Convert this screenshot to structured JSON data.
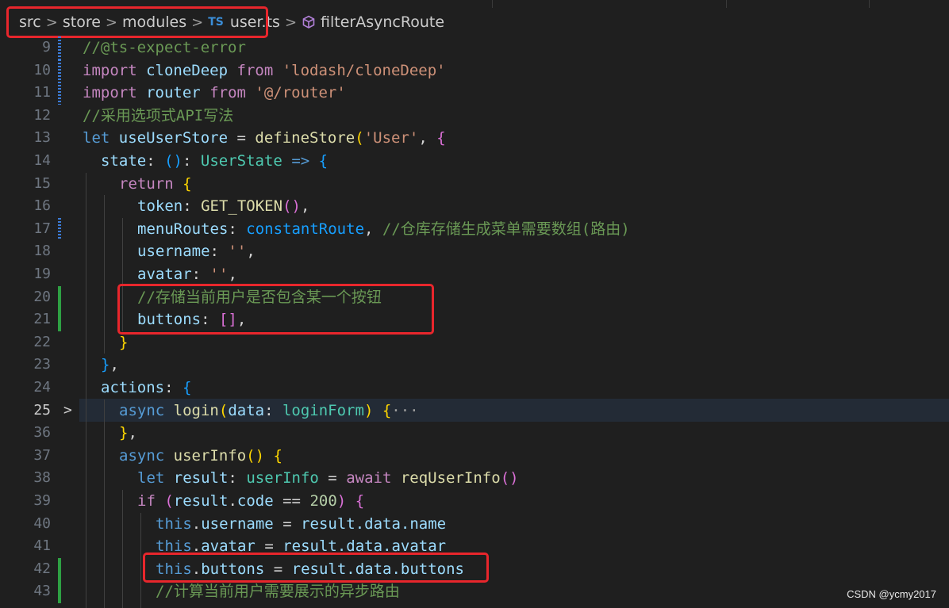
{
  "breadcrumb": {
    "items": [
      "src",
      "store",
      "modules",
      "user.ts",
      "filterAsyncRoute"
    ],
    "ts_badge": "TS",
    "separator": ">"
  },
  "gutter": {
    "line_numbers": [
      "9",
      "10",
      "11",
      "12",
      "13",
      "14",
      "15",
      "16",
      "17",
      "18",
      "19",
      "20",
      "21",
      "22",
      "23",
      "24",
      "25",
      "36",
      "37",
      "38",
      "39",
      "40",
      "41",
      "42",
      "43"
    ],
    "fold_chevron": ">"
  },
  "code": {
    "l9": {
      "comment": "//@ts-expect-error"
    },
    "l10": {
      "kw": "import",
      "name": "cloneDeep",
      "from": "from",
      "sp": " ",
      "str": "'lodash/cloneDeep'"
    },
    "l11": {
      "kw": "import",
      "name": "router",
      "from": "from",
      "str": "'@/router'"
    },
    "l12": {
      "comment": "//采用选项式API写法"
    },
    "l13": {
      "kw": "let",
      "name": "useUserStore",
      "eq": "=",
      "fn": "defineStore",
      "paren": "(",
      "str": "'User'",
      "comma": ",",
      "brace": "{"
    },
    "l14": {
      "prop": "state",
      "colon": ":",
      "paren": "()",
      "colon2": ":",
      "type": "UserState",
      "arrow": "=>",
      "brace": "{"
    },
    "l15": {
      "kw": "return",
      "brace": "{"
    },
    "l16": {
      "prop": "token",
      "colon": ":",
      "fn": "GET_TOKEN",
      "paren": "()",
      "comma": ","
    },
    "l17": {
      "prop": "menuRoutes",
      "colon": ":",
      "val": "constantRoute",
      "comma": ",",
      "comment": "//仓库存储生成菜单需要数组(路由)"
    },
    "l18": {
      "prop": "username",
      "colon": ":",
      "str": "''",
      "comma": ","
    },
    "l19": {
      "prop": "avatar",
      "colon": ":",
      "str": "''",
      "comma": ","
    },
    "l20": {
      "comment": "//存储当前用户是否包含某一个按钮"
    },
    "l21": {
      "prop": "buttons",
      "colon": ":",
      "arr": "[]",
      "comma": ","
    },
    "l22": {
      "brace": "}"
    },
    "l23": {
      "brace": "}",
      "comma": ","
    },
    "l24": {
      "prop": "actions",
      "colon": ":",
      "brace": "{"
    },
    "l25": {
      "kw": "async",
      "fn": "login",
      "paren": "(",
      "param": "data",
      "colon": ":",
      "type": "loginForm",
      "paren2": ")",
      "brace": "{",
      "dots": "···"
    },
    "l36": {
      "brace": "}",
      "comma": ","
    },
    "l37": {
      "kw": "async",
      "fn": "userInfo",
      "paren": "()",
      "brace": "{"
    },
    "l38": {
      "kw": "let",
      "name": "result",
      "colon": ":",
      "type": "userInfo",
      "eq": "=",
      "await": "await",
      "fn": "reqUserInfo",
      "paren": "()"
    },
    "l39": {
      "kw": "if",
      "paren": "(",
      "obj": "result",
      "dot": ".",
      "prop": "code",
      "op": "==",
      "num": "200",
      "paren2": ")",
      "brace": "{"
    },
    "l40": {
      "this": "this",
      "dot": ".",
      "prop": "username",
      "eq": "=",
      "rhs": "result.data.name"
    },
    "l41": {
      "this": "this",
      "dot": ".",
      "prop": "avatar",
      "eq": "=",
      "rhs": "result.data.avatar"
    },
    "l42": {
      "this": "this",
      "dot": ".",
      "prop": "buttons",
      "eq": "=",
      "rhs": "result.data.buttons"
    },
    "l43": {
      "comment": "//计算当前用户需要展示的异步路由"
    }
  },
  "watermark": "CSDN @ycmy2017",
  "colors": {
    "background": "#1f1f1f",
    "annotation_box": "#e8262c",
    "comment": "#6a9955",
    "keyword": "#569cd6"
  }
}
